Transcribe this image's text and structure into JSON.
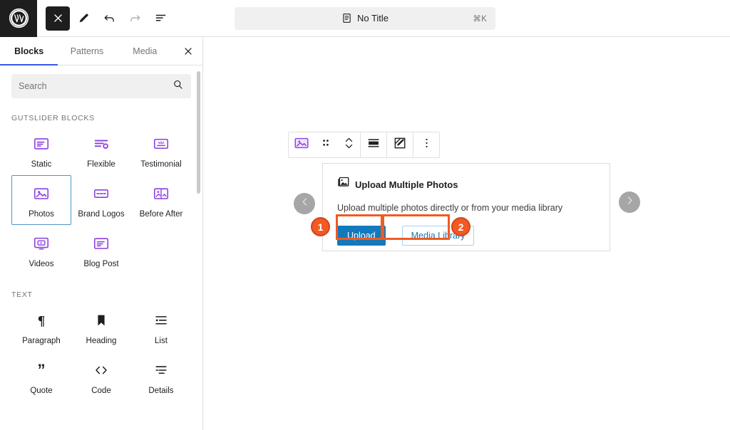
{
  "topbar": {
    "logo_icon": "wordpress-logo-icon",
    "tools": [
      {
        "name": "close-editor-button",
        "icon": "close-icon",
        "style": "dark",
        "disabled": false
      },
      {
        "name": "edit-mode-button",
        "icon": "pencil-icon",
        "style": "plain",
        "disabled": false
      },
      {
        "name": "undo-button",
        "icon": "undo-arrow-icon",
        "style": "plain",
        "disabled": false
      },
      {
        "name": "redo-button",
        "icon": "redo-arrow-icon",
        "style": "plain",
        "disabled": true
      },
      {
        "name": "list-view-button",
        "icon": "list-view-icon",
        "style": "plain",
        "disabled": false
      }
    ],
    "command_bar": {
      "icon": "document-icon",
      "title": "No Title",
      "shortcut": "⌘K"
    }
  },
  "sidebar": {
    "tabs": [
      {
        "label": "Blocks",
        "active": true
      },
      {
        "label": "Patterns",
        "active": false
      },
      {
        "label": "Media",
        "active": false
      }
    ],
    "close_icon": "close-icon",
    "search": {
      "placeholder": "Search",
      "value": "",
      "icon": "search-icon"
    },
    "categories": [
      {
        "label": "GUTSLIDER BLOCKS",
        "blocks": [
          {
            "label": "Static",
            "icon": "static-slide-icon",
            "selected": false
          },
          {
            "label": "Flexible",
            "icon": "flexible-slide-icon",
            "selected": false
          },
          {
            "label": "Testimonial",
            "icon": "testimonial-icon",
            "selected": false
          },
          {
            "label": "Photos",
            "icon": "photos-icon",
            "selected": true
          },
          {
            "label": "Brand Logos",
            "icon": "brand-logos-icon",
            "selected": false
          },
          {
            "label": "Before After",
            "icon": "before-after-icon",
            "selected": false
          },
          {
            "label": "Videos",
            "icon": "videos-icon",
            "selected": false
          },
          {
            "label": "Blog Post",
            "icon": "blog-post-icon",
            "selected": false
          }
        ]
      },
      {
        "label": "TEXT",
        "blocks": [
          {
            "label": "Paragraph",
            "icon": "paragraph-pilcrow-icon",
            "selected": false
          },
          {
            "label": "Heading",
            "icon": "heading-bookmark-icon",
            "selected": false
          },
          {
            "label": "List",
            "icon": "list-icon",
            "selected": false
          },
          {
            "label": "Quote",
            "icon": "quote-icon",
            "selected": false
          },
          {
            "label": "Code",
            "icon": "code-brackets-icon",
            "selected": false
          },
          {
            "label": "Details",
            "icon": "details-icon",
            "selected": false
          }
        ]
      }
    ],
    "colors": {
      "icon_purple": "#8b3fe0",
      "selected_border": "#4f94c4",
      "active_tab_underline": "#3858e9"
    }
  },
  "canvas": {
    "block_toolbar": {
      "items": [
        {
          "name": "block-type-photos-button",
          "icon": "photos-block-icon"
        },
        {
          "name": "drag-handle",
          "icon": "drag-dots-icon"
        },
        {
          "name": "move-updown-button",
          "icon": "chevron-up-down-icon"
        },
        {
          "name": "align-button",
          "icon": "align-wide-icon"
        },
        {
          "name": "edit-block-button",
          "icon": "edit-square-icon"
        },
        {
          "name": "more-options-button",
          "icon": "kebab-menu-icon"
        }
      ]
    },
    "upload_panel": {
      "icon": "stacked-photos-icon",
      "title": "Upload Multiple Photos",
      "description": "Upload multiple photos directly or from your media library",
      "upload_button": "Upload",
      "media_library_button": "Media Library"
    },
    "nav": {
      "prev_icon": "chevron-left-icon",
      "next_icon": "chevron-right-icon"
    },
    "annotations": [
      {
        "number": "1",
        "target": "upload-button"
      },
      {
        "number": "2",
        "target": "media-library-button"
      }
    ],
    "colors": {
      "upload_blue": "#1279bd",
      "annotation_orange": "#f15a22",
      "annotation_border": "#d6441a",
      "nav_gray": "#a6a6a6"
    }
  }
}
